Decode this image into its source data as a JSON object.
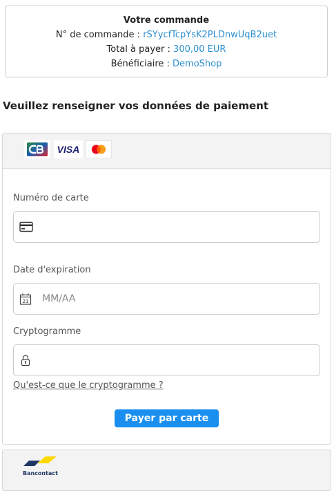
{
  "order": {
    "title": "Votre commande",
    "order_number_label": "N° de commande : ",
    "order_number": "rSYycfTcpYsK2PLDnwUqB2uet",
    "total_label": "Total à payer : ",
    "total": "300,00 EUR",
    "beneficiary_label": "Bénéficiaire : ",
    "beneficiary": "DemoShop"
  },
  "heading": "Veuillez renseigner vos données de paiement",
  "card_brands": [
    "CB",
    "VISA",
    "Mastercard"
  ],
  "form": {
    "card_number_label": "Numéro de carte",
    "expiry_label": "Date d'expiration",
    "expiry_placeholder": "MM/AA",
    "cvv_label": "Cryptogramme",
    "cvv_help": "Qu'est-ce que le cryptogramme ?",
    "pay_button": "Payer par carte"
  },
  "alt_method": {
    "name": "Bancontact"
  },
  "colors": {
    "accent": "#1b8ff0",
    "link": "#2b8fd0"
  }
}
